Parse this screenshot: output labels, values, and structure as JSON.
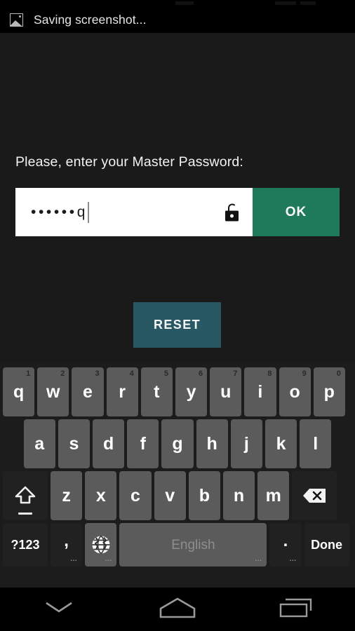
{
  "statusbar": {
    "ghost_icons": [
      "signal-ghost",
      "wifi-ghost",
      "battery-ghost"
    ]
  },
  "notification": {
    "icon": "image-icon",
    "text": "Saving screenshot..."
  },
  "dialog": {
    "prompt": "Please, enter your Master Password:",
    "password_field": {
      "masked_value": "••••••q",
      "placeholder": "",
      "icon": "unlock-icon"
    },
    "ok_label": "OK",
    "reset_label": "RESET",
    "colors": {
      "ok_button": "#1e7a5a",
      "reset_button": "#285863",
      "background": "#1a1a1a"
    }
  },
  "keyboard": {
    "row1": [
      {
        "key": "q",
        "hint": "1"
      },
      {
        "key": "w",
        "hint": "2"
      },
      {
        "key": "e",
        "hint": "3"
      },
      {
        "key": "r",
        "hint": "4"
      },
      {
        "key": "t",
        "hint": "5"
      },
      {
        "key": "y",
        "hint": "6"
      },
      {
        "key": "u",
        "hint": "7"
      },
      {
        "key": "i",
        "hint": "8"
      },
      {
        "key": "o",
        "hint": "9"
      },
      {
        "key": "p",
        "hint": "0"
      }
    ],
    "row2": [
      {
        "key": "a"
      },
      {
        "key": "s"
      },
      {
        "key": "d"
      },
      {
        "key": "f"
      },
      {
        "key": "g"
      },
      {
        "key": "h"
      },
      {
        "key": "j"
      },
      {
        "key": "k"
      },
      {
        "key": "l"
      }
    ],
    "row3": [
      {
        "key": "z"
      },
      {
        "key": "x"
      },
      {
        "key": "c"
      },
      {
        "key": "v"
      },
      {
        "key": "b"
      },
      {
        "key": "n"
      },
      {
        "key": "m"
      }
    ],
    "shift_icon": "shift-arrow-icon",
    "backspace_icon": "backspace-icon",
    "row4": {
      "symbols_label": "?123",
      "comma_label": ",",
      "comma_hint": "...",
      "globe_icon": "globe-language-icon",
      "globe_hint": "...",
      "space_label": "English",
      "space_hint": "...",
      "period_label": ".",
      "period_hint": "...",
      "done_label": "Done"
    }
  },
  "navbar": {
    "back_icon": "chevron-down-icon",
    "home_icon": "home-pentagon-icon",
    "recents_icon": "recents-icon"
  }
}
